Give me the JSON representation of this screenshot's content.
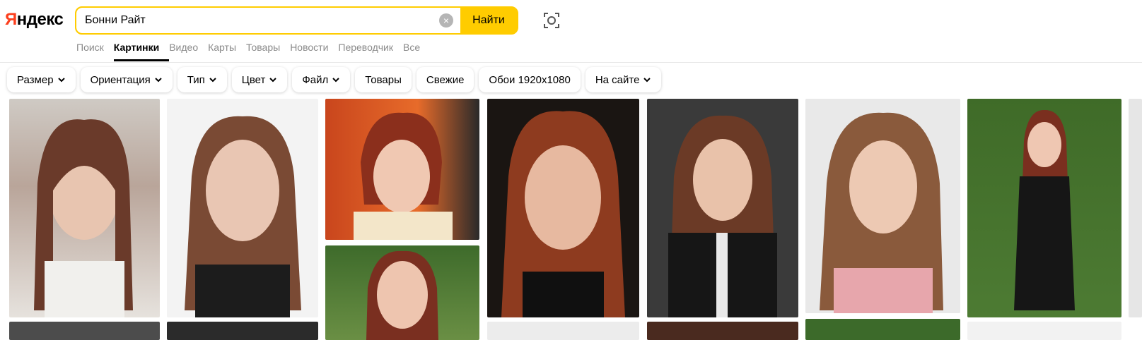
{
  "header": {
    "logo_first": "Я",
    "logo_rest": "ндекс",
    "search_value": "Бонни Райт",
    "search_button": "Найти",
    "clear_symbol": "×"
  },
  "tabs": [
    {
      "label": "Поиск",
      "active": false
    },
    {
      "label": "Картинки",
      "active": true
    },
    {
      "label": "Видео",
      "active": false
    },
    {
      "label": "Карты",
      "active": false
    },
    {
      "label": "Товары",
      "active": false
    },
    {
      "label": "Новости",
      "active": false
    },
    {
      "label": "Переводчик",
      "active": false
    },
    {
      "label": "Все",
      "active": false
    }
  ],
  "filters": [
    {
      "label": "Размер",
      "dropdown": true
    },
    {
      "label": "Ориентация",
      "dropdown": true
    },
    {
      "label": "Тип",
      "dropdown": true
    },
    {
      "label": "Цвет",
      "dropdown": true
    },
    {
      "label": "Файл",
      "dropdown": true
    },
    {
      "label": "Товары",
      "dropdown": false
    },
    {
      "label": "Свежие",
      "dropdown": false
    },
    {
      "label": "Обои 1920x1080",
      "dropdown": false
    },
    {
      "label": "На сайте",
      "dropdown": true
    }
  ],
  "colors": {
    "accent": "#ffcc00",
    "logo_red": "#fc3f1d",
    "tab_inactive": "#8a8a8a"
  }
}
